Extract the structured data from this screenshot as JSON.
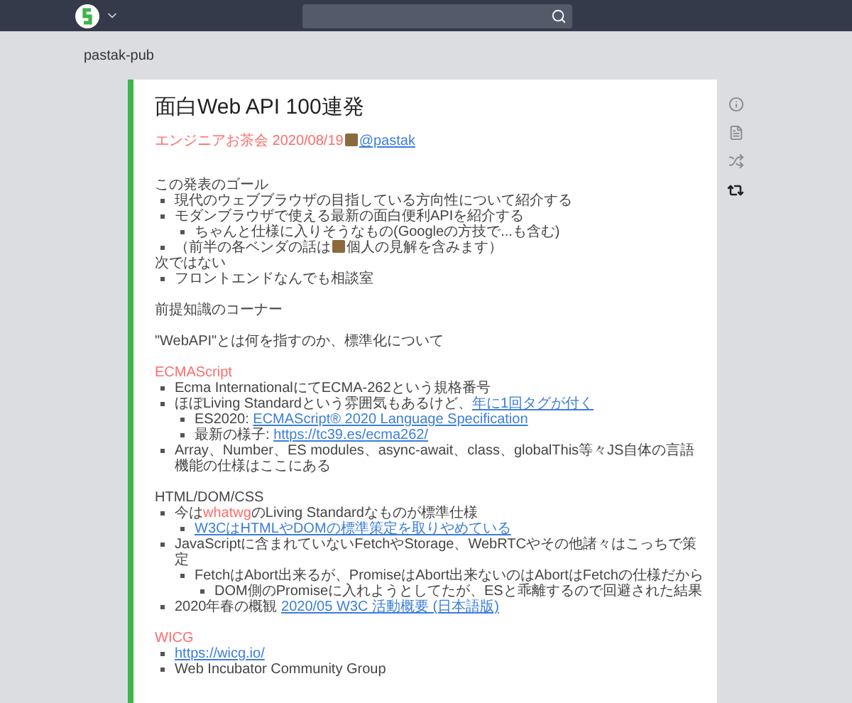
{
  "project": "pastak-pub",
  "page": {
    "title": "面白Web API 100連発",
    "meta": [
      {
        "kind": "red",
        "text": "エンジニアお茶会 2020/08/19"
      },
      {
        "kind": "avatar"
      },
      {
        "kind": "link",
        "text": "@pastak"
      }
    ],
    "blocks": [
      {
        "lines": [
          {
            "kind": "plain",
            "segments": [
              {
                "kind": "text",
                "text": "この発表のゴール"
              }
            ]
          },
          {
            "kind": "bullet",
            "segments": [
              {
                "kind": "text",
                "text": "現代のウェブブラウザの目指している方向性について紹介する"
              }
            ]
          },
          {
            "kind": "bullet",
            "segments": [
              {
                "kind": "text",
                "text": "モダンブラウザで使える最新の面白便利APIを紹介する"
              }
            ],
            "children": [
              {
                "kind": "bullet",
                "segments": [
                  {
                    "kind": "text",
                    "text": "ちゃんと仕様に入りそうなもの(Googleの方技で...も含む)"
                  }
                ]
              }
            ]
          },
          {
            "kind": "bullet",
            "segments": [
              {
                "kind": "text",
                "text": "（前半の各ベンダの話は"
              },
              {
                "kind": "avatar"
              },
              {
                "kind": "text",
                "text": "個人の見解を含みます）"
              }
            ]
          },
          {
            "kind": "plain",
            "segments": [
              {
                "kind": "text",
                "text": "次ではない"
              }
            ]
          },
          {
            "kind": "bullet",
            "segments": [
              {
                "kind": "text",
                "text": "フロントエンドなんでも相談室"
              }
            ]
          }
        ]
      },
      {
        "lines": [
          {
            "kind": "plain",
            "segments": [
              {
                "kind": "text",
                "text": "前提知識のコーナー"
              }
            ]
          }
        ]
      },
      {
        "lines": [
          {
            "kind": "plain",
            "segments": [
              {
                "kind": "text",
                "text": "\"WebAPI\"とは何を指すのか、標準化について"
              }
            ]
          }
        ]
      },
      {
        "lines": [
          {
            "kind": "plain",
            "segments": [
              {
                "kind": "red",
                "text": "ECMAScript"
              }
            ]
          },
          {
            "kind": "bullet",
            "segments": [
              {
                "kind": "text",
                "text": "Ecma InternationalにてECMA-262という規格番号"
              }
            ]
          },
          {
            "kind": "bullet",
            "segments": [
              {
                "kind": "text",
                "text": "ほぼLiving Standardという雰囲気もあるけど、"
              },
              {
                "kind": "link",
                "text": "年に1回タグが付く"
              }
            ],
            "children": [
              {
                "kind": "bullet",
                "segments": [
                  {
                    "kind": "text",
                    "text": "ES2020: "
                  },
                  {
                    "kind": "link",
                    "text": "ECMAScript® 2020 Language Specification"
                  }
                ]
              },
              {
                "kind": "bullet",
                "segments": [
                  {
                    "kind": "text",
                    "text": "最新の様子: "
                  },
                  {
                    "kind": "link",
                    "text": "https://tc39.es/ecma262/"
                  }
                ]
              }
            ]
          },
          {
            "kind": "bullet",
            "segments": [
              {
                "kind": "text",
                "text": "Array、Number、ES modules、async-await、class、globalThis等々JS自体の言語機能の仕様はここにある"
              }
            ]
          }
        ]
      },
      {
        "lines": [
          {
            "kind": "plain",
            "segments": [
              {
                "kind": "text",
                "text": "HTML/DOM/CSS"
              }
            ]
          },
          {
            "kind": "bullet",
            "segments": [
              {
                "kind": "text",
                "text": "今は"
              },
              {
                "kind": "red",
                "text": "whatwg"
              },
              {
                "kind": "text",
                "text": "のLiving Standardなものが標準仕様"
              }
            ],
            "children": [
              {
                "kind": "bullet",
                "segments": [
                  {
                    "kind": "link",
                    "text": "W3CはHTMLやDOMの標準策定を取りやめている"
                  }
                ]
              }
            ]
          },
          {
            "kind": "bullet",
            "segments": [
              {
                "kind": "text",
                "text": "JavaScriptに含まれていないFetchやStorage、WebRTCやその他諸々はこっちで策定"
              }
            ],
            "children": [
              {
                "kind": "bullet",
                "segments": [
                  {
                    "kind": "text",
                    "text": "FetchはAbort出来るが、PromiseはAbort出来ないのはAbortはFetchの仕様だから"
                  }
                ],
                "children": [
                  {
                    "kind": "bullet",
                    "segments": [
                      {
                        "kind": "text",
                        "text": "DOM側のPromiseに入れようとしてたが、ESと乖離するので回避された結果"
                      }
                    ]
                  }
                ]
              }
            ]
          },
          {
            "kind": "bullet",
            "segments": [
              {
                "kind": "text",
                "text": "2020年春の概観 "
              },
              {
                "kind": "link",
                "text": "2020/05 W3C 活動概要 (日本語版)"
              }
            ]
          }
        ]
      },
      {
        "lines": [
          {
            "kind": "plain",
            "segments": [
              {
                "kind": "red",
                "text": "WICG"
              }
            ]
          },
          {
            "kind": "bullet",
            "segments": [
              {
                "kind": "link",
                "text": "https://wicg.io/"
              }
            ]
          },
          {
            "kind": "bullet",
            "segments": [
              {
                "kind": "text",
                "text": "Web Incubator Community Group"
              }
            ]
          }
        ]
      }
    ]
  }
}
